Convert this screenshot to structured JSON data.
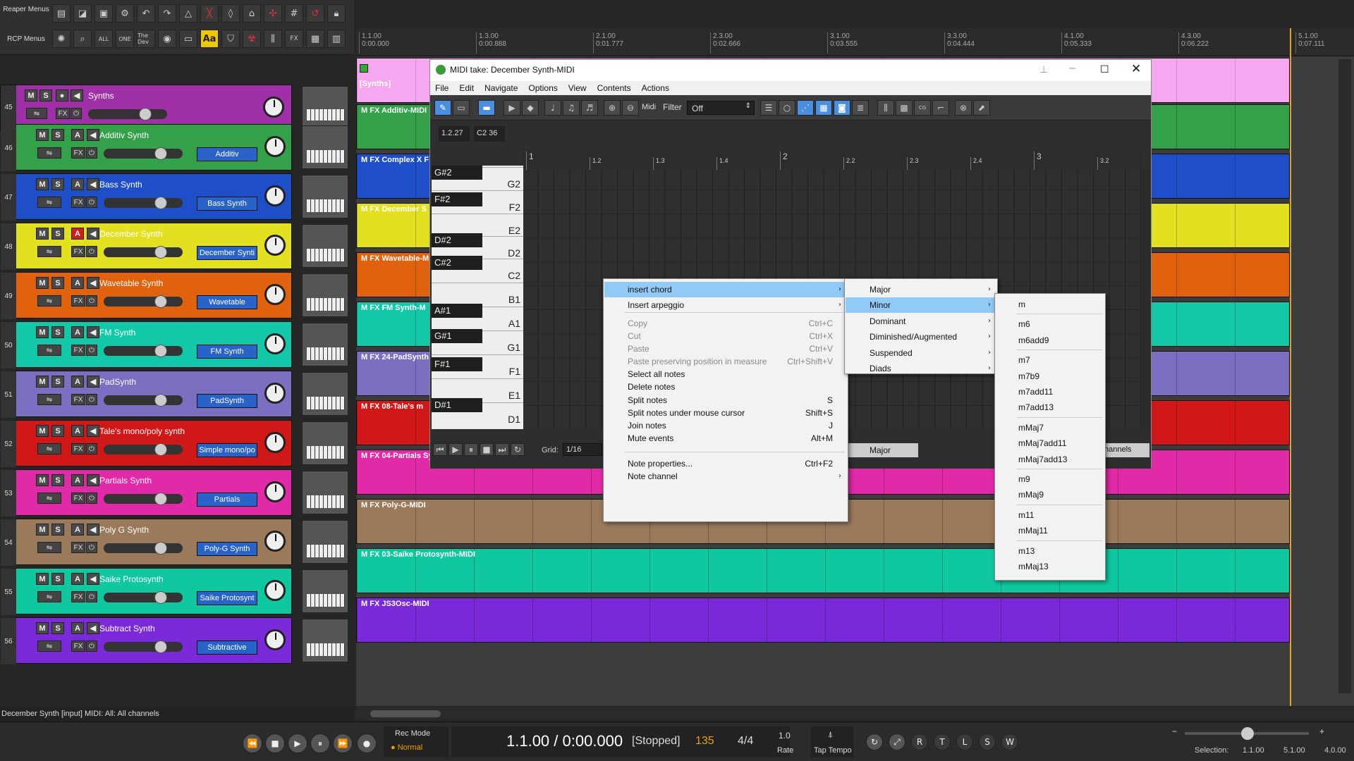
{
  "toolbar": {
    "reaper_menus": "Reaper Menus",
    "rcp_menus": "RCP Menus",
    "all": "ALL",
    "one": "ONE",
    "thedev": "The Dev",
    "fx": "FX"
  },
  "ruler": {
    "marks": [
      {
        "bar": "1.1.00",
        "time": "0:00.000"
      },
      {
        "bar": "1.3.00",
        "time": "0:00.888"
      },
      {
        "bar": "2.1.00",
        "time": "0:01.777"
      },
      {
        "bar": "2.3.00",
        "time": "0:02.666"
      },
      {
        "bar": "3.1.00",
        "time": "0:03.555"
      },
      {
        "bar": "3.3.00",
        "time": "0:04.444"
      },
      {
        "bar": "4.1.00",
        "time": "0:05.333"
      },
      {
        "bar": "4.3.00",
        "time": "0:06.222"
      },
      {
        "bar": "5.1.00",
        "time": "0:07.111"
      }
    ]
  },
  "folder": {
    "num": "45",
    "name": "Synths",
    "mute": "M",
    "solo": "S",
    "fx": "FX"
  },
  "tracks": [
    {
      "num": "46",
      "name": "Additiv Synth",
      "fx": "Additiv",
      "item": "M FX Additiv-MIDI",
      "color": "#35a04a"
    },
    {
      "num": "47",
      "name": "Bass Synth",
      "fx": "Bass Synth",
      "item": "M FX Complex X F",
      "color": "#1e4fc8"
    },
    {
      "num": "48",
      "name": "December Synth",
      "fx": "December Synti",
      "item": "M FX December S",
      "color": "#e3e022"
    },
    {
      "num": "49",
      "name": "Wavetable Synth",
      "fx": "Wavetable",
      "item": "M FX Wavetable-M",
      "color": "#e0620f"
    },
    {
      "num": "50",
      "name": "FM Synth",
      "fx": "FM Synth",
      "item": "M FX FM Synth-M",
      "color": "#12c8a8"
    },
    {
      "num": "51",
      "name": "PadSynth",
      "fx": "PadSynth",
      "item": "M FX 24-PadSynth",
      "color": "#7a6fc0"
    },
    {
      "num": "52",
      "name": "Tale's mono/poly synth",
      "fx": "Simple mono/po",
      "item": "M FX 08-Tale's m",
      "color": "#d01818"
    },
    {
      "num": "53",
      "name": "Partials Synth",
      "fx": "Partials",
      "item": "M FX 04-Partials Synth-MIDI",
      "color": "#e02aa8"
    },
    {
      "num": "54",
      "name": "Poly G Synth",
      "fx": "Poly-G Synth",
      "item": "M FX Poly-G-MIDI",
      "color": "#9a7a5a"
    },
    {
      "num": "55",
      "name": "Saike Protosynth",
      "fx": "Saike Protosynt",
      "item": "M FX 03-Saike Protosynth-MIDI",
      "color": "#10c8a0"
    },
    {
      "num": "56",
      "name": "Subtract Synth",
      "fx": "Subtractive",
      "item": "M FX JS3Osc-MIDI",
      "color": "#7a2ad8"
    }
  ],
  "track_buttons": {
    "m": "M",
    "s": "S",
    "a": "A",
    "fx": "FX"
  },
  "folder_item": "[Synths]",
  "midi": {
    "title": "MIDI take: December Synth-MIDI",
    "menu": [
      "File",
      "Edit",
      "Navigate",
      "Options",
      "View",
      "Contents",
      "Actions"
    ],
    "midi_label": "Midi",
    "filter_label": "Filter",
    "filter_value": "Off",
    "pos": "1.2.27",
    "note": "C2  36",
    "grid_label": "Grid:",
    "grid_value": "1/16",
    "scale": "Major",
    "channels": "hannels",
    "ruler": [
      "1",
      "1.2",
      "1.3",
      "1.4",
      "2",
      "2.2",
      "2.3",
      "2.4",
      "3",
      "3.2"
    ]
  },
  "keys": {
    "black": [
      "G#2",
      "F#2",
      "D#2",
      "C#2",
      "A#1",
      "G#1",
      "F#1",
      "D#1"
    ],
    "white": [
      "G2",
      "F2",
      "E2",
      "D2",
      "C2",
      "B1",
      "A1",
      "G1",
      "F1",
      "E1",
      "D1"
    ]
  },
  "context_menu": [
    {
      "label": "insert chord",
      "arrow": "›",
      "hl": true
    },
    {
      "label": "Insert arpeggio",
      "arrow": "›"
    },
    {
      "label": "Copy",
      "sc": "Ctrl+C",
      "dis": true
    },
    {
      "label": "Cut",
      "sc": "Ctrl+X",
      "dis": true
    },
    {
      "label": "Paste",
      "sc": "Ctrl+V",
      "dis": true
    },
    {
      "label": "Paste preserving position in measure",
      "sc": "Ctrl+Shift+V",
      "dis": true
    },
    {
      "label": "Select all notes"
    },
    {
      "label": "Delete notes"
    },
    {
      "label": "Split notes",
      "sc": "S"
    },
    {
      "label": "Split notes under mouse cursor",
      "sc": "Shift+S"
    },
    {
      "label": "Join notes",
      "sc": "J"
    },
    {
      "label": "Mute events",
      "sc": "Alt+M"
    },
    {
      "label": "Note properties...",
      "sc": "Ctrl+F2"
    },
    {
      "label": "Note channel",
      "arrow": "›"
    }
  ],
  "chord_menu": [
    {
      "label": "Major"
    },
    {
      "label": "Minor",
      "hl": true
    },
    {
      "label": "Dominant"
    },
    {
      "label": "Diminished/Augmented"
    },
    {
      "label": "Suspended"
    },
    {
      "label": "Diads"
    }
  ],
  "minor_menu": [
    "m",
    "m6",
    "m6add9",
    "m7",
    "m7b9",
    "m7add11",
    "m7add13",
    "mMaj7",
    "mMaj7add11",
    "mMaj7add13",
    "m9",
    "mMaj9",
    "m11",
    "mMaj11",
    "m13",
    "mMaj13"
  ],
  "status": "December Synth [input] MIDI: All: All channels",
  "transport": {
    "rec_mode": "Rec Mode",
    "rec_value": "Normal",
    "position": "1.1.00 / 0:00.000",
    "state": "[Stopped]",
    "bpm": "135",
    "sig": "4/4",
    "rate_val": "1.0",
    "rate": "Rate",
    "tap": "Tap Tempo",
    "sel_label": "Selection:",
    "sel_start": "1.1.00",
    "sel_end": "5.1.00",
    "sel_len": "4.0.00"
  }
}
